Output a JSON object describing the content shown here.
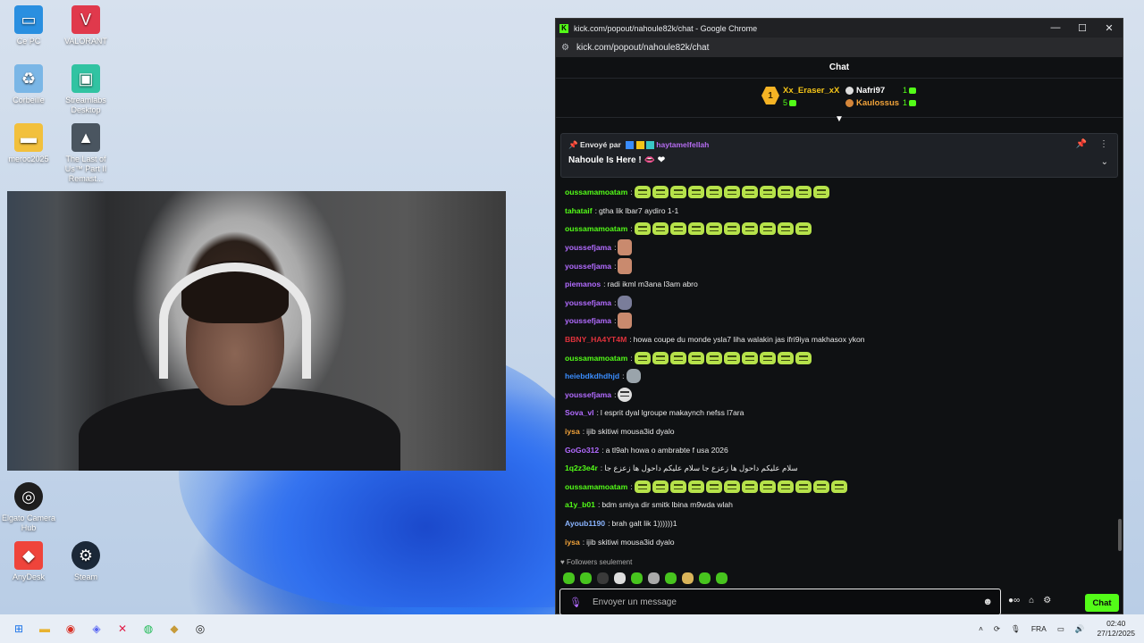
{
  "desktop": {
    "icons": [
      {
        "label": "Ce PC",
        "icon": "monitor-icon",
        "color": "#2a8fe0"
      },
      {
        "label": "VALORANT",
        "icon": "valorant-icon",
        "color": "#e0394c"
      },
      {
        "label": "Corbeille",
        "icon": "recycle-bin-icon",
        "color": "#7ab6e6"
      },
      {
        "label": "Streamlabs Desktop",
        "icon": "streamlabs-icon",
        "color": "#31c3a2"
      },
      {
        "label": "meroc2025",
        "icon": "folder-icon",
        "color": "#f2c03c"
      },
      {
        "label": "The Last of Us™ Part II Remast...",
        "icon": "game-icon",
        "color": "#4a5560"
      },
      {
        "label": "Elgato Camera Hub",
        "icon": "elgato-icon",
        "color": "#1e1e1e"
      },
      {
        "label": "AnyDesk",
        "icon": "anydesk-icon",
        "color": "#ef443b"
      },
      {
        "label": "Steam",
        "icon": "steam-icon",
        "color": "#1b2838"
      }
    ]
  },
  "browser": {
    "title": "kick.com/popout/nahoule82k/chat - Google Chrome",
    "url": "kick.com/popout/nahoule82k/chat",
    "minimize": "—",
    "maximize": "☐",
    "close": "✕"
  },
  "chat": {
    "header": "Chat",
    "leaderboard": {
      "rank": "1",
      "first_name": "Xx_Eraser_xX",
      "first_count": "5",
      "second_name": "Nafri97",
      "second_count": "1",
      "third_name": "Kaulossus",
      "third_count": "1"
    },
    "pinned": {
      "sent_by": "Envoyé par",
      "sender": "haytamelfellah",
      "message": "Nahoule Is Here ! 👄 ❤"
    },
    "messages": [
      {
        "user": "oussamamoatam",
        "color": "#53fc18",
        "text": "",
        "emotes": 11,
        "emote": "frog"
      },
      {
        "user": "tahataif",
        "color": "#53fc18",
        "text": "gtha lik lbar7 aydiro 1-1",
        "emotes": 0
      },
      {
        "user": "oussamamoatam",
        "color": "#53fc18",
        "text": "",
        "emotes": 10,
        "emote": "frog"
      },
      {
        "user": "youssefjama",
        "color": "#b26bff",
        "text": "",
        "emotes": 1,
        "emote": "hand"
      },
      {
        "user": "youssefjama",
        "color": "#b26bff",
        "text": "",
        "emotes": 1,
        "emote": "hand"
      },
      {
        "user": "piemanos",
        "color": "#b26bff",
        "text": "radi ikml m3ana l3am abro",
        "emotes": 0
      },
      {
        "user": "youssefjama",
        "color": "#b26bff",
        "text": "",
        "emotes": 1,
        "emote": "blob"
      },
      {
        "user": "youssefjama",
        "color": "#b26bff",
        "text": "",
        "emotes": 1,
        "emote": "hand"
      },
      {
        "user": "BBNY_HA4YT4M",
        "color": "#e0323c",
        "text": "howa coupe du monde ysla7 liha walakin jas ifri9iya makhasox ykon",
        "emotes": 0
      },
      {
        "user": "oussamamoatam",
        "color": "#53fc18",
        "text": "",
        "emotes": 10,
        "emote": "frog"
      },
      {
        "user": "heiebdkdhdhjd",
        "color": "#3a8dff",
        "text": "",
        "emotes": 1,
        "emote": "dog"
      },
      {
        "user": "youssefjama",
        "color": "#b26bff",
        "text": "",
        "emotes": 1,
        "emote": "face"
      },
      {
        "user": "Sova_vl",
        "color": "#b26bff",
        "text": "l esprit dyal lgroupe makaynch nefss l7ara",
        "emotes": 0
      },
      {
        "user": "iysa",
        "color": "#f0a23a",
        "text": "ijib skitiwi mousa3id dyalo",
        "emotes": 0
      },
      {
        "user": "GoGo312",
        "color": "#b26bff",
        "text": "a tl9ah howa o ambrabte f usa 2026",
        "emotes": 0
      },
      {
        "user": "1q2z3e4r",
        "color": "#53fc18",
        "text": "سلام عليكم داحول ها زعزع جا سلام عليكم داحول ها زعزع جا",
        "emotes": 0
      },
      {
        "user": "oussamamoatam",
        "color": "#53fc18",
        "text": "",
        "emotes": 12,
        "emote": "frog"
      },
      {
        "user": "a1y_b01",
        "color": "#53fc18",
        "text": "bdm smiya dir smitk lbina m9wda wlah",
        "emotes": 0
      },
      {
        "user": "Ayoub1190",
        "color": "#8ab4ff",
        "text": "brah galt lik 1))))))1",
        "emotes": 0
      },
      {
        "user": "iysa",
        "color": "#f0a23a",
        "text": "ijib skitiwi mousa3id dyalo",
        "emotes": 0
      }
    ],
    "followers_only": "Followers seulement",
    "input_placeholder": "Envoyer un message",
    "send_label": "Chat"
  },
  "taskbar": {
    "language": "FRA",
    "time": "02:40",
    "date": "27/12/2025"
  }
}
